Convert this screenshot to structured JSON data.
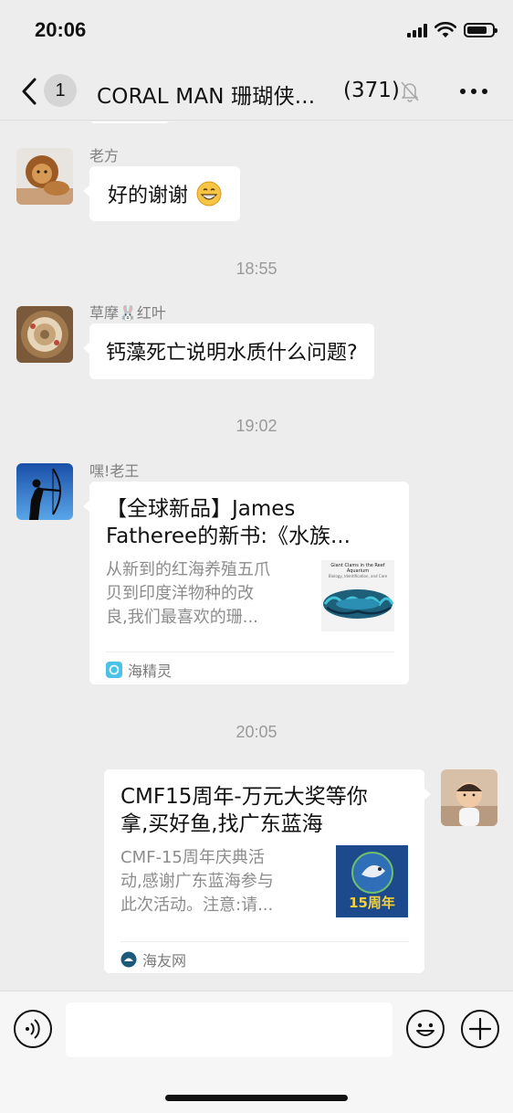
{
  "status_bar": {
    "time": "20:06"
  },
  "nav": {
    "back_badge": "1",
    "title": "CORAL MAN 珊瑚侠...",
    "member_count": "(371)"
  },
  "messages": [
    {
      "type": "text",
      "sender": "老方",
      "text": "好的谢谢",
      "emoji": "grinning-face"
    },
    {
      "type": "timestamp",
      "text": "18:55"
    },
    {
      "type": "text",
      "sender": "草摩🐰红叶",
      "text": "钙藻死亡说明水质什么问题?"
    },
    {
      "type": "timestamp",
      "text": "19:02"
    },
    {
      "type": "card",
      "sender": "嘿!老王",
      "title_line1": "【全球新品】James",
      "title_line2": "Fatheree的新书:《水族...",
      "desc_line1": "从新到的红海养殖五爪",
      "desc_line2": "贝到印度洋物种的改",
      "desc_line3": "良,我们最喜欢的珊...",
      "thumb_title": "Giant Clams in the Reef Aquarium",
      "thumb_subtitle": "Biology, Identification, and Care",
      "source": "海精灵"
    },
    {
      "type": "timestamp",
      "text": "20:05"
    },
    {
      "type": "card",
      "sender": "self",
      "title_line1": "CMF15周年-万元大奖等你",
      "title_line2": "拿,买好鱼,找广东蓝海",
      "desc_line1": "CMF-15周年庆典活",
      "desc_line2": "动,感谢广东蓝海参与",
      "desc_line3": "此次活动。注意:请...",
      "thumb_text": "15周年",
      "source": "海友网"
    }
  ],
  "input": {
    "placeholder": ""
  },
  "colors": {
    "background": "#ededed",
    "bubble": "#ffffff",
    "timestamp": "#9a9a9a"
  }
}
